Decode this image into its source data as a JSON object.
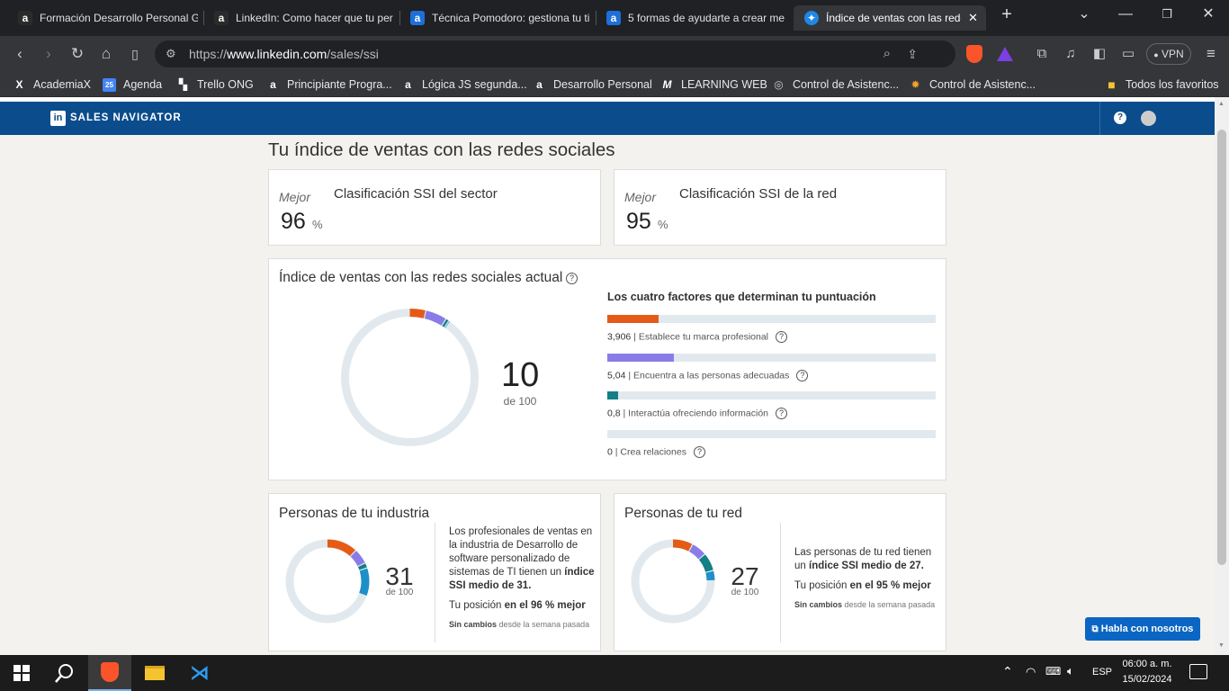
{
  "browser": {
    "tabs": [
      {
        "label": "Formación Desarrollo Personal G",
        "icon": "academia-icon"
      },
      {
        "label": "LinkedIn: Como hacer que tu per",
        "icon": "academia-icon"
      },
      {
        "label": "Técnica Pomodoro: gestiona tu ti",
        "icon": "academia-blue-icon"
      },
      {
        "label": "5 formas de ayudarte a crear me",
        "icon": "academia-blue-icon"
      },
      {
        "label": "Índice de ventas con las rede",
        "icon": "compass-icon"
      }
    ],
    "url_prefix": "https://",
    "url_domain": "www.linkedin.com",
    "url_path": "/sales/ssi",
    "vpn_label": "VPN",
    "bookmarks": [
      {
        "label": "AcademiaX",
        "icon": "x-icon"
      },
      {
        "label": "Agenda",
        "icon": "calendar-icon"
      },
      {
        "label": "Trello ONG",
        "icon": "trello-icon"
      },
      {
        "label": "Principiante Progra...",
        "icon": "academia-icon"
      },
      {
        "label": "Lógica JS segunda...",
        "icon": "academia-icon"
      },
      {
        "label": "Desarrollo Personal",
        "icon": "academia-icon"
      },
      {
        "label": "LEARNING WEB",
        "icon": "m-icon"
      },
      {
        "label": "Control de Asistenc...",
        "icon": "globe-icon"
      },
      {
        "label": "Control de Asistenc...",
        "icon": "gear-icon"
      }
    ],
    "all_favorites": "Todos los favoritos"
  },
  "linkedin": {
    "brand": "SALES NAVIGATOR",
    "page_title": "Tu índice de ventas con las redes sociales",
    "sector": {
      "prefix": "Mejor",
      "title": "Clasificación SSI del sector",
      "value": "96",
      "unit": "%"
    },
    "network": {
      "prefix": "Mejor",
      "title": "Clasificación SSI de la red",
      "value": "95",
      "unit": "%"
    },
    "ssi": {
      "title": "Índice de ventas con las redes sociales actual",
      "score": "10",
      "out_of": "de 100",
      "factors_title": "Los cuatro factores que determinan tu puntuación",
      "factors": [
        {
          "value": "3,906",
          "label": "Establece tu marca profesional",
          "fraction": 0.156,
          "color": "#e45b17"
        },
        {
          "value": "5,04",
          "label": "Encuentra a las personas adecuadas",
          "fraction": 0.2016,
          "color": "#8a7ce8"
        },
        {
          "value": "0,8",
          "label": "Interactúa ofreciendo información",
          "fraction": 0.032,
          "color": "#137f86"
        },
        {
          "value": "0",
          "label": "Crea relaciones",
          "fraction": 0,
          "color": "#1f8fc9"
        }
      ]
    },
    "industry": {
      "title": "Personas de tu industria",
      "score": "31",
      "out_of": "de 100",
      "segments": [
        12,
        6,
        2,
        11
      ],
      "text": "Los profesionales de ventas en la industria de Desarrollo de software personalizado de sistemas de TI tienen un",
      "text_bold": "índice SSI medio de 31.",
      "position_prefix": "Tu posición",
      "position_bold": "en el 96 % mejor",
      "change_bold": "Sin cambios",
      "change_rest": "desde la semana pasada"
    },
    "network_people": {
      "title": "Personas de tu red",
      "score": "27",
      "out_of": "de 100",
      "segments": [
        8,
        6,
        7,
        4
      ],
      "text": "Las personas de tu red tienen un",
      "text_bold": "índice SSI medio de 27.",
      "position_prefix": "Tu posición",
      "position_bold": "en el 95 % mejor",
      "change_bold": "Sin cambios",
      "change_rest": "desde la semana pasada"
    },
    "chat_button": "Habla con nosotros"
  },
  "taskbar": {
    "lang": "ESP",
    "time": "06:00 a. m.",
    "date": "15/02/2024"
  },
  "colors": {
    "orange": "#e45b17",
    "purple": "#8a7ce8",
    "teal": "#137f86",
    "blue": "#1f8fc9",
    "track": "#e1e9ee",
    "navy": "#0b4c8c"
  }
}
